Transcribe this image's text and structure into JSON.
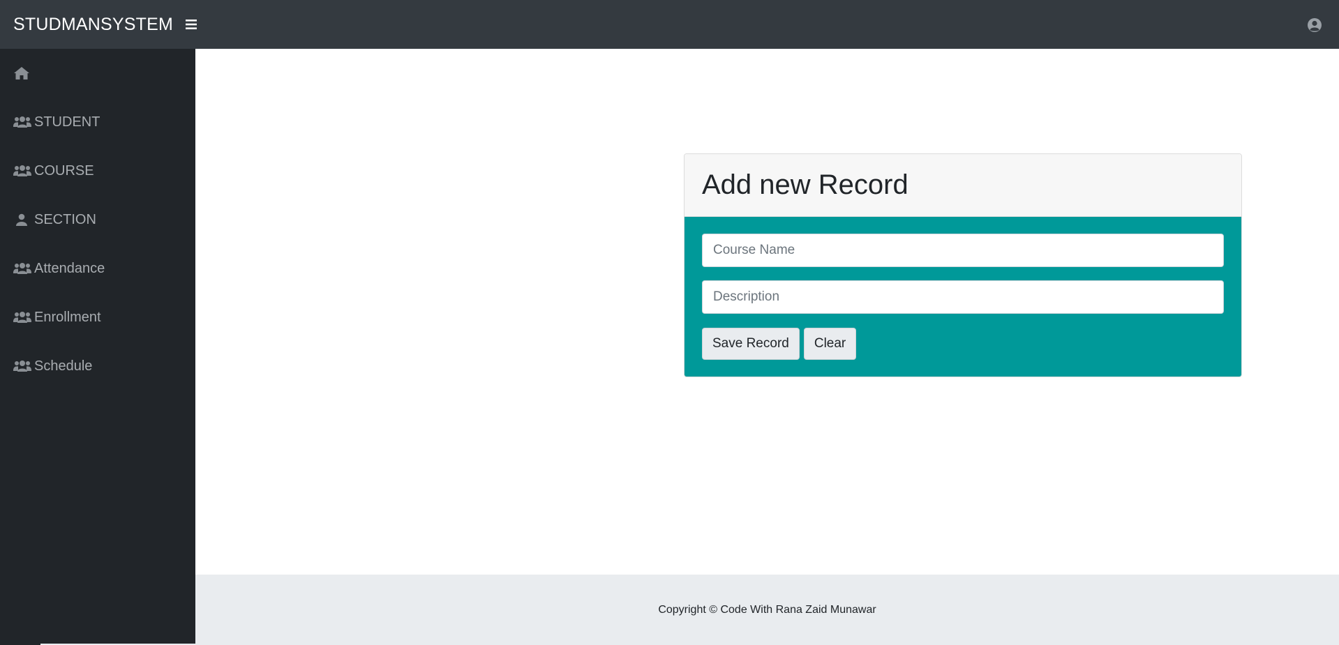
{
  "header": {
    "brand": "STUDMANSYSTEM",
    "menu_icon": "bars-icon",
    "user_icon": "user-circle-icon"
  },
  "sidebar": {
    "items": [
      {
        "label": "",
        "icon": "home-icon"
      },
      {
        "label": "STUDENT",
        "icon": "users-icon"
      },
      {
        "label": "COURSE",
        "icon": "users-icon"
      },
      {
        "label": "SECTION",
        "icon": "user-icon"
      },
      {
        "label": "Attendance",
        "icon": "users-icon"
      },
      {
        "label": "Enrollment",
        "icon": "users-icon"
      },
      {
        "label": "Schedule",
        "icon": "users-icon"
      }
    ]
  },
  "form": {
    "title": "Add new Record",
    "course_name": {
      "value": "",
      "placeholder": "Course Name"
    },
    "description": {
      "value": "",
      "placeholder": "Description"
    },
    "save_label": "Save Record",
    "clear_label": "Clear"
  },
  "footer": {
    "text": "Copyright © Code With Rana Zaid Munawar"
  },
  "colors": {
    "topbar": "#343a40",
    "sidebar": "#212529",
    "form_body": "#009999",
    "footer": "#e9ecef"
  }
}
